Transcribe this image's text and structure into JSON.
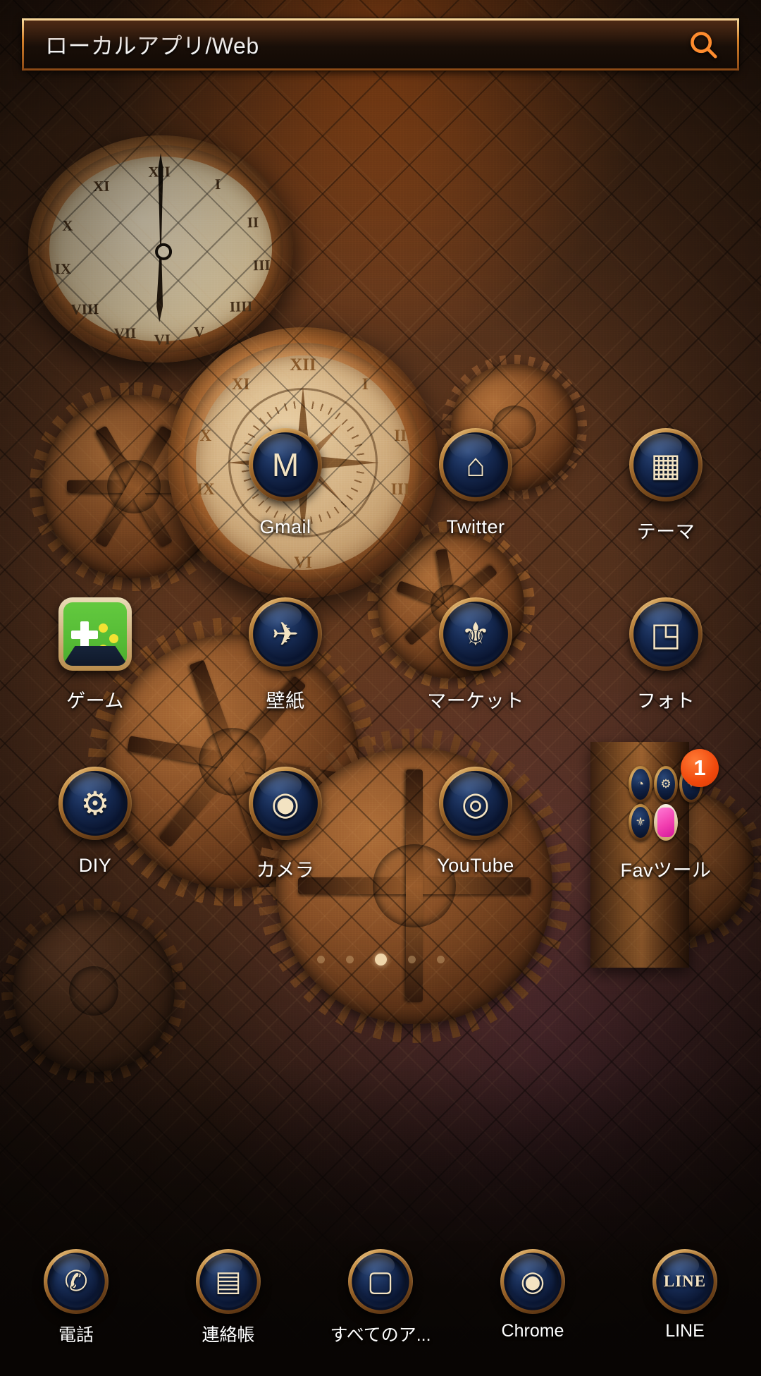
{
  "search": {
    "value": "ローカルアプリ/Web",
    "placeholder": "ローカルアプリ/Web",
    "icon": "search-icon",
    "accent_color": "#d8832c"
  },
  "wallpaper": {
    "theme": "steampunk-gears-clock",
    "base_color": "#46291a",
    "accent_color": "#a8642c"
  },
  "grid": {
    "rows": [
      {
        "cells": [
          {
            "label": "",
            "icon": "",
            "empty": true
          },
          {
            "label": "Gmail",
            "icon": "gmail-icon",
            "glyph": "M",
            "empty": false
          },
          {
            "label": "Twitter",
            "icon": "twitter-icon",
            "glyph": "⌂",
            "empty": false
          },
          {
            "label": "テーマ",
            "icon": "theme-icon",
            "glyph": "▦",
            "empty": false
          }
        ]
      },
      {
        "cells": [
          {
            "label": "ゲーム",
            "icon": "games-gamepad-icon",
            "glyph": "",
            "empty": false
          },
          {
            "label": "壁紙",
            "icon": "wallpaper-icon",
            "glyph": "✈",
            "empty": false
          },
          {
            "label": "マーケット",
            "icon": "market-icon",
            "glyph": "⚜",
            "empty": false
          },
          {
            "label": "フォト",
            "icon": "photo-icon",
            "glyph": "◳",
            "empty": false
          }
        ]
      },
      {
        "cells": [
          {
            "label": "DIY",
            "icon": "diy-icon",
            "glyph": "⚙",
            "empty": false
          },
          {
            "label": "カメラ",
            "icon": "camera-icon",
            "glyph": "◉",
            "empty": false
          },
          {
            "label": "YouTube",
            "icon": "youtube-icon",
            "glyph": "◎",
            "empty": false
          },
          {
            "label": "Favツール",
            "icon": "fav-tools-folder-icon",
            "glyph": "",
            "empty": false
          }
        ]
      }
    ]
  },
  "folder": {
    "name": "Favツール",
    "badge_count": "1",
    "badge_color": "#f0480c",
    "mini_icons": [
      {
        "name": "clock-mini-icon",
        "glyph": "◔"
      },
      {
        "name": "gear-mini-icon",
        "glyph": "⚙"
      },
      {
        "name": "compass-mini-icon",
        "glyph": "✦"
      },
      {
        "name": "lamp-mini-icon",
        "glyph": "⚜"
      },
      {
        "name": "pink-app-mini-icon",
        "glyph": ""
      }
    ]
  },
  "pager": {
    "total": 5,
    "active_index": 2
  },
  "dock": {
    "items": [
      {
        "label": "電話",
        "icon": "phone-icon",
        "glyph": "✆"
      },
      {
        "label": "連絡帳",
        "icon": "contacts-icon",
        "glyph": "▤"
      },
      {
        "label": "すべてのア...",
        "icon": "all-apps-icon",
        "glyph": "▢"
      },
      {
        "label": "Chrome",
        "icon": "chrome-icon",
        "glyph": "◉"
      },
      {
        "label": "LINE",
        "icon": "line-icon",
        "glyph": "LINE"
      }
    ]
  }
}
